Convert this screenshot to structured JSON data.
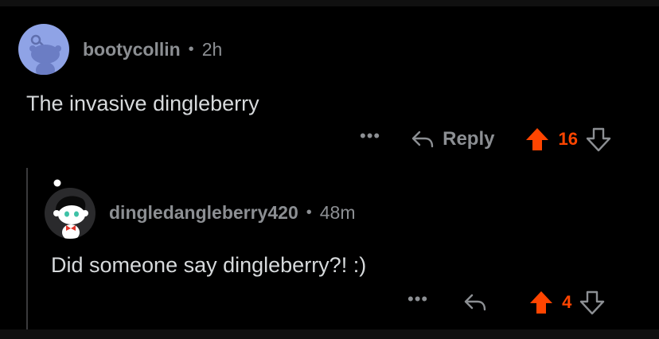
{
  "comments": [
    {
      "username": "bootycollin",
      "separator": "•",
      "age": "2h",
      "text": "The invasive dingleberry",
      "more_label": "•••",
      "reply_label": "Reply",
      "score": "16",
      "icons": {
        "avatar": "snoo-avatar-icon",
        "more": "more-options-icon",
        "reply": "reply-arrow-icon",
        "upvote": "upvote-arrow-icon",
        "downvote": "downvote-arrow-icon"
      }
    },
    {
      "username": "dingledangleberry420",
      "separator": "•",
      "age": "48m",
      "text": "Did someone say dingleberry?! :)",
      "more_label": "•••",
      "score": "4",
      "icons": {
        "avatar": "snoo-avatar-icon",
        "more": "more-options-icon",
        "reply": "reply-arrow-icon",
        "upvote": "upvote-arrow-icon",
        "downvote": "downvote-arrow-icon"
      }
    }
  ],
  "colors": {
    "background": "#000000",
    "meta_text": "#8c8f93",
    "body_text": "#d7dadc",
    "upvote_active": "#ff4500",
    "avatar1_bg": "#8fa3e6",
    "thread_line": "#3a3a3c"
  }
}
